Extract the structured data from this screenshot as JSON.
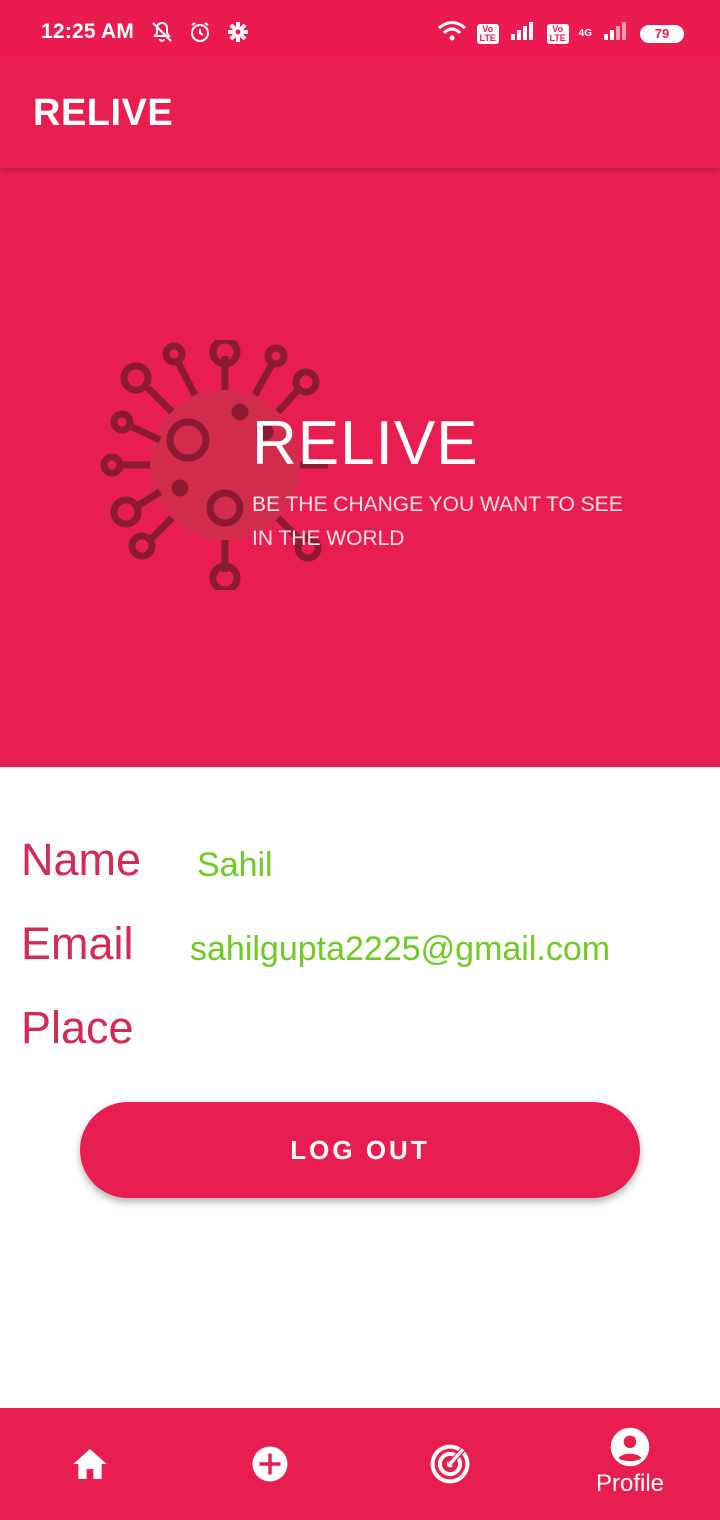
{
  "status_bar": {
    "time": "12:25 AM",
    "battery": "79",
    "network": "4G",
    "volte": "Vo LTE",
    "icons": [
      "mute-bell-icon",
      "alarm-icon",
      "gear-icon",
      "wifi-icon",
      "signal-icon",
      "signal-icon",
      "battery-icon"
    ]
  },
  "app_bar": {
    "title": "RELIVE"
  },
  "banner": {
    "brand": "RELIVE",
    "tagline_line1": "BE THE CHANGE YOU WANT TO SEE",
    "tagline_line2": "IN THE WORLD"
  },
  "profile": {
    "name_label": "Name",
    "name_value": "Sahil",
    "email_label": "Email",
    "email_value": "sahilgupta2225@gmail.com",
    "place_label": "Place",
    "place_value": ""
  },
  "actions": {
    "logout_label": "LOG OUT"
  },
  "bottom_nav": {
    "items": [
      {
        "icon": "home-icon"
      },
      {
        "icon": "add-circle-icon"
      },
      {
        "icon": "radar-icon"
      },
      {
        "icon": "account-circle-icon",
        "label": "Profile"
      }
    ],
    "active": "Profile"
  },
  "colors": {
    "primary": "#e91e50",
    "status_bar": "#eb1a4f",
    "label": "#d42a54",
    "value": "#6dcb23",
    "virus": "#8c1a33"
  }
}
